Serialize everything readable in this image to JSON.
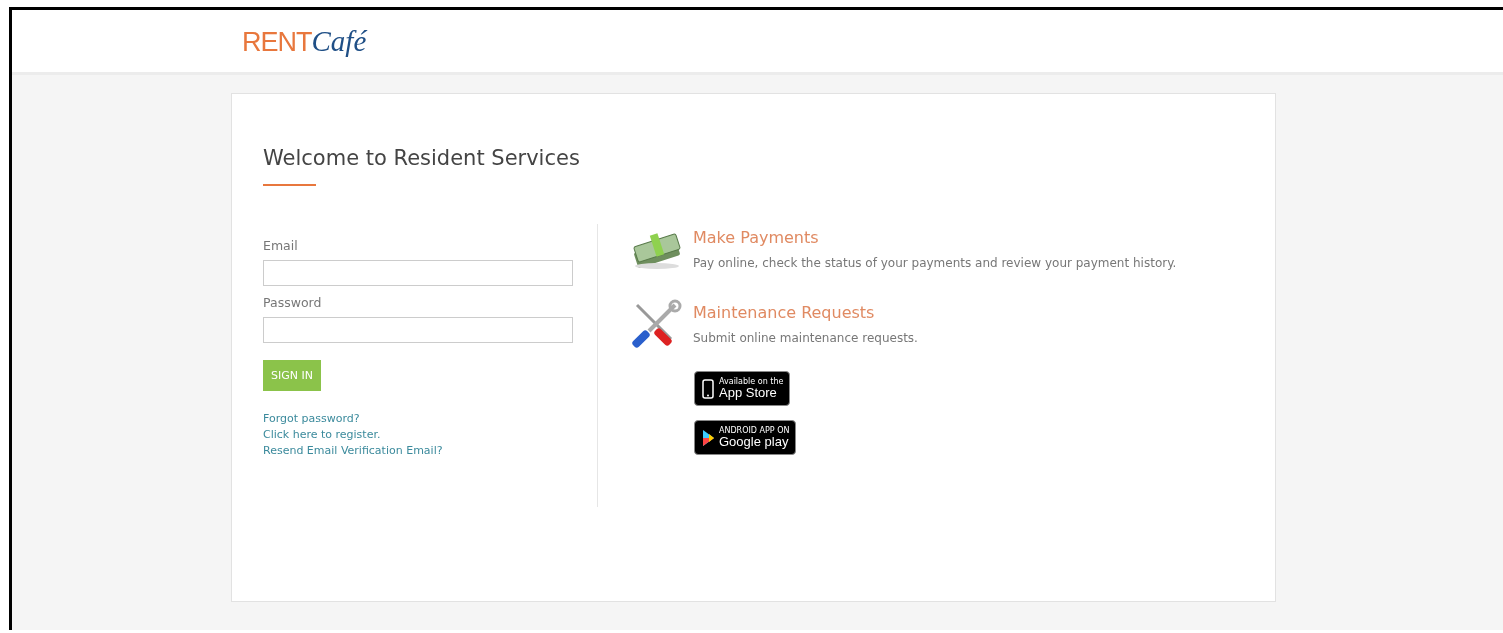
{
  "header": {
    "logo": {
      "part_1": "RENT",
      "part_2": "Café"
    }
  },
  "title": "Welcome to Resident Services",
  "login": {
    "fields": [
      {
        "label": "Email"
      },
      {
        "label": "Password"
      }
    ],
    "button": "SIGN IN",
    "links": [
      "Forgot password?",
      "Click here to register.",
      "Resend Email Verification Email?"
    ]
  },
  "features": [
    {
      "kind": "money",
      "title": "Make Payments",
      "text": "Pay online, check the status of your payments and review your payment history."
    },
    {
      "kind": "tools",
      "title": "Maintenance Requests",
      "text": "Submit online maintenance requests."
    }
  ],
  "badges": [
    {
      "kind": "apple",
      "small": "Available on the",
      "big": "App Store"
    },
    {
      "kind": "android",
      "small": "ANDROID APP ON",
      "big": "Google play"
    }
  ]
}
